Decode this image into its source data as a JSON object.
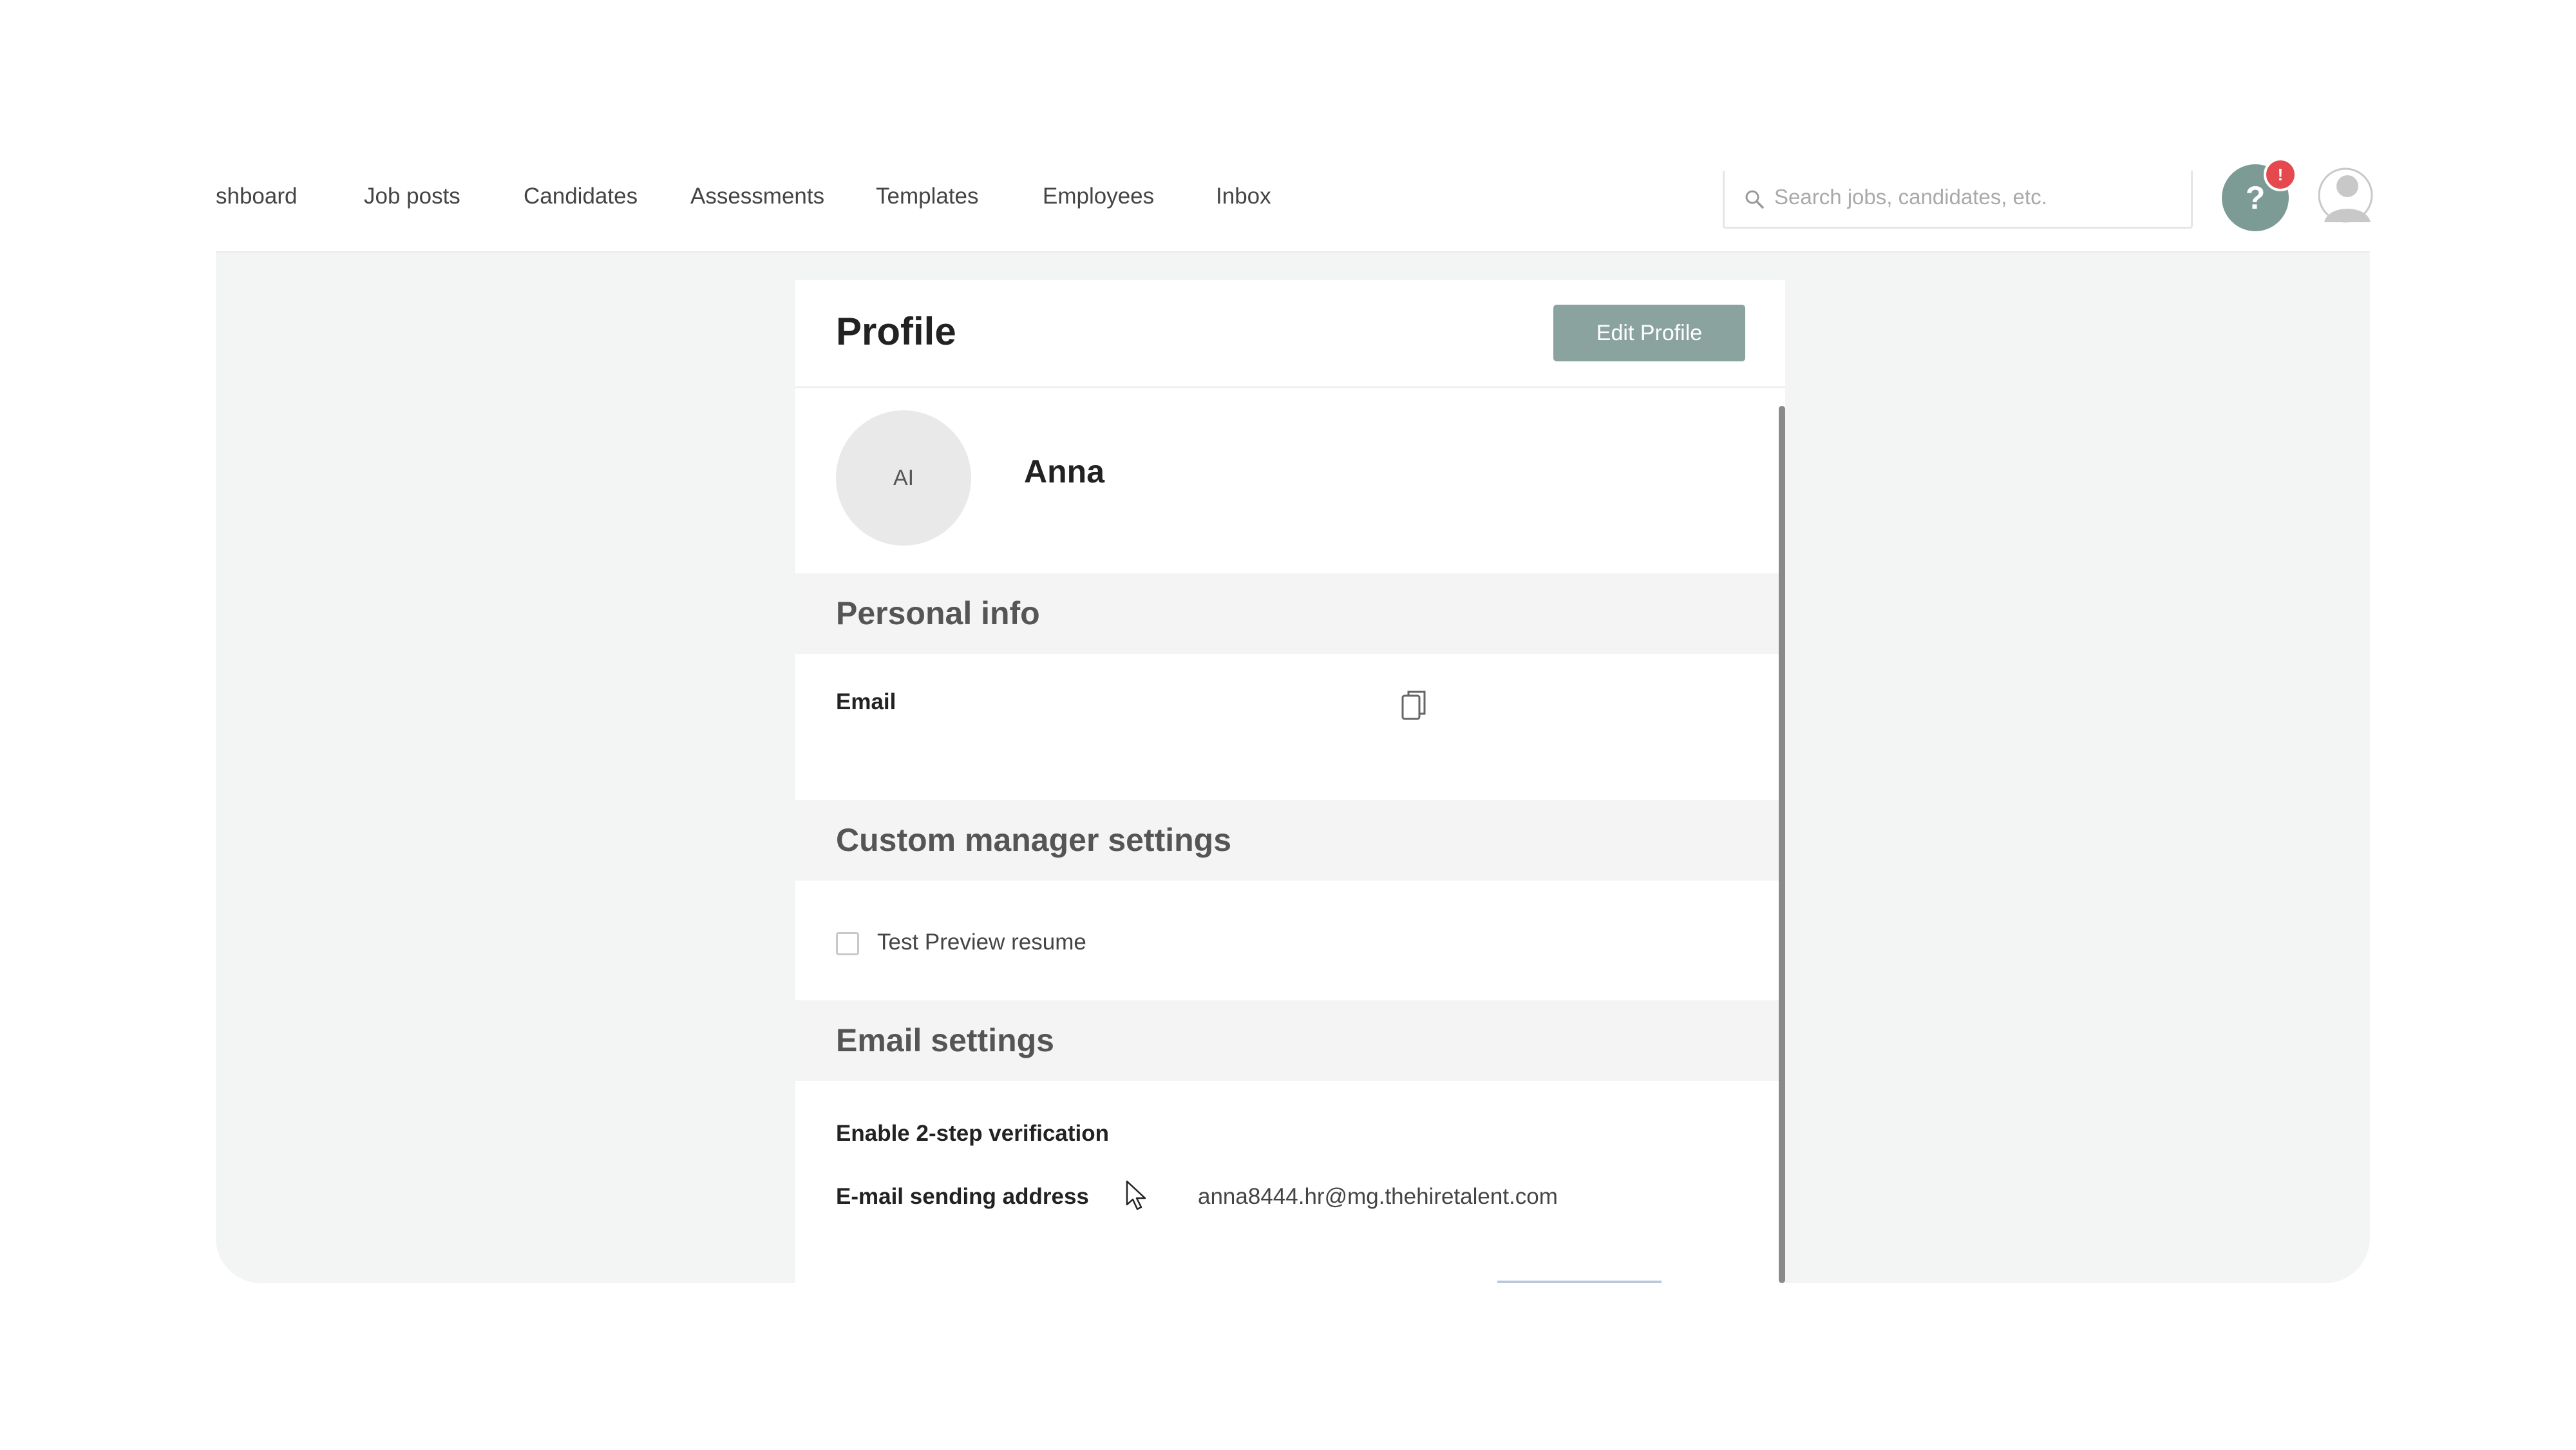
{
  "nav": {
    "items": [
      {
        "label": "shboard"
      },
      {
        "label": "Job posts"
      },
      {
        "label": "Candidates"
      },
      {
        "label": "Assessments"
      },
      {
        "label": "Templates"
      },
      {
        "label": "Employees"
      },
      {
        "label": "Inbox"
      }
    ],
    "search_placeholder": "Search jobs, candidates, etc.",
    "help_label": "?",
    "help_badge": "!"
  },
  "profile": {
    "title": "Profile",
    "edit_button": "Edit Profile",
    "avatar_initials": "AI",
    "name": "Anna"
  },
  "personal_info": {
    "heading": "Personal info",
    "email_label": "Email"
  },
  "custom_manager": {
    "heading": "Custom manager settings",
    "checkbox_label": "Test Preview resume"
  },
  "email_settings": {
    "heading": "Email settings",
    "two_step_label": "Enable 2-step verification",
    "sending_address_label": "E-mail sending address",
    "sending_address_value": "anna8444.hr@mg.thehiretalent.com"
  },
  "colors": {
    "accent": "#7c9b94",
    "edit_button": "#8ba39e",
    "badge": "#e5484d",
    "background": "#f3f5f4"
  }
}
